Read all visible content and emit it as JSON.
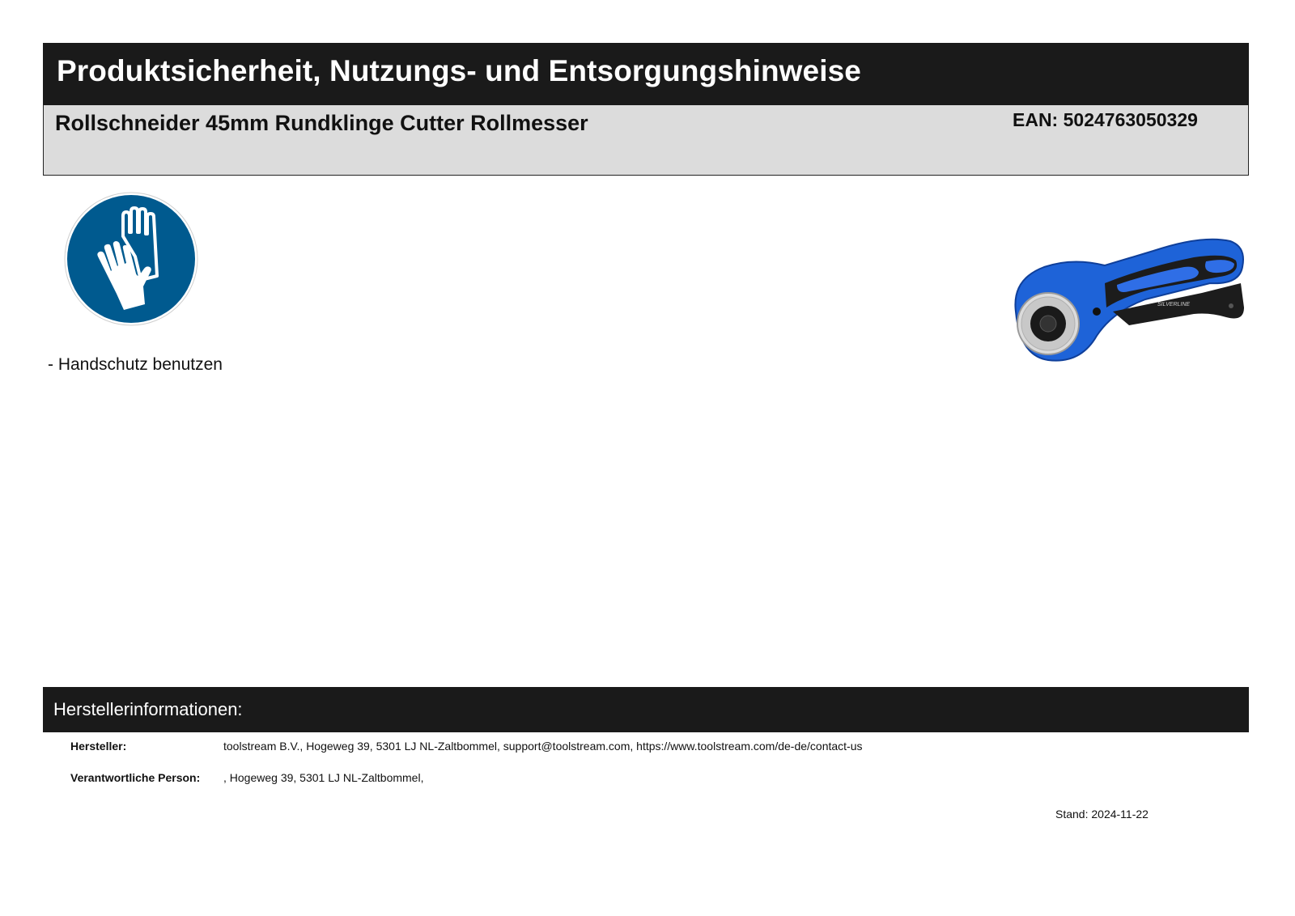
{
  "header": {
    "title": "Produktsicherheit, Nutzungs- und Entsorgungshinweise"
  },
  "product": {
    "name": "Rollschneider 45mm Rundklinge Cutter Rollmesser",
    "ean": "EAN: 5024763050329",
    "image_icon": "rotary-cutter-image"
  },
  "safety": {
    "sign_icon": "gloves-icon",
    "sign_color": "#005a8f",
    "hint": "- Handschutz benutzen"
  },
  "manufacturer": {
    "heading": "Herstellerinformationen:",
    "rows": [
      {
        "label": "Hersteller:",
        "value": "toolstream B.V., Hogeweg 39, 5301 LJ NL-Zaltbommel, support@toolstream.com, https://www.toolstream.com/de-de/contact-us"
      },
      {
        "label": "Verantwortliche Person:",
        "value": ", Hogeweg 39, 5301 LJ NL-Zaltbommel,"
      }
    ]
  },
  "footer": {
    "stand": "Stand: 2024-11-22"
  }
}
